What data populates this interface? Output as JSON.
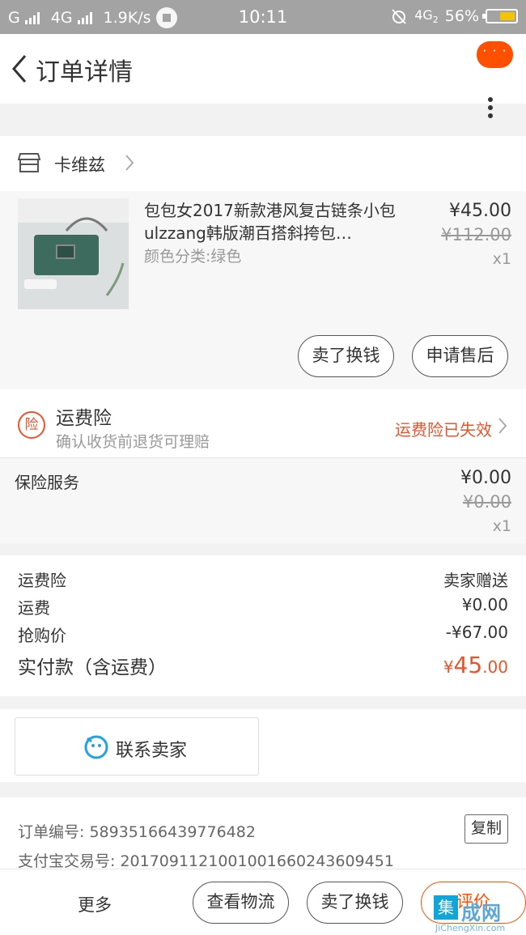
{
  "status_bar": {
    "carrier1": "G",
    "carrier2": "4G",
    "speed": "1.9K/s",
    "time": "10:11",
    "network": "4G",
    "network_sub": "2",
    "battery": "56%",
    "battery_level_percent": 56
  },
  "nav": {
    "title": "订单详情",
    "more_bubble": "· · ·"
  },
  "shop": {
    "name": "卡维兹"
  },
  "item": {
    "title": "包包女2017新款港风复古链条小包ulzzang韩版潮百搭斜挎包…",
    "spec": "颜色分类:绿色",
    "price": "¥45.00",
    "original_price": "¥112.00",
    "quantity": "x1",
    "sell_button": "卖了换钱",
    "aftersale_button": "申请售后"
  },
  "insurance": {
    "badge": "险",
    "title": "运费险",
    "subtitle": "确认收货前退货可理赔",
    "status": "运费险已失效"
  },
  "service": {
    "label": "保险服务",
    "price": "¥0.00",
    "original_price": "¥0.00",
    "quantity": "x1"
  },
  "fees": {
    "rows": [
      {
        "label": "运费险",
        "value": "卖家赠送"
      },
      {
        "label": "运费",
        "value": "¥0.00"
      },
      {
        "label": "抢购价",
        "value": "-¥67.00"
      }
    ],
    "total_label": "实付款（含运费）",
    "total_currency": "¥",
    "total_integer": "45",
    "total_decimal": ".00"
  },
  "contact": {
    "label": "联系卖家"
  },
  "order": {
    "order_no": "订单编号: 58935166439776482",
    "alipay_no": "支付宝交易号: 2017091121001001660243609451",
    "copy_button": "复制"
  },
  "bottom_bar": {
    "more": "更多",
    "logistics": "查看物流",
    "sell": "卖了换钱",
    "review": "评价"
  },
  "watermark": {
    "box": "集",
    "text": "成网",
    "url": "JiChengXin.com"
  },
  "colors": {
    "accent": "#ff5000",
    "warning_text": "#e8542b",
    "status_bar_bg": "#a3a3a3",
    "battery_fill": "#f5c400"
  }
}
